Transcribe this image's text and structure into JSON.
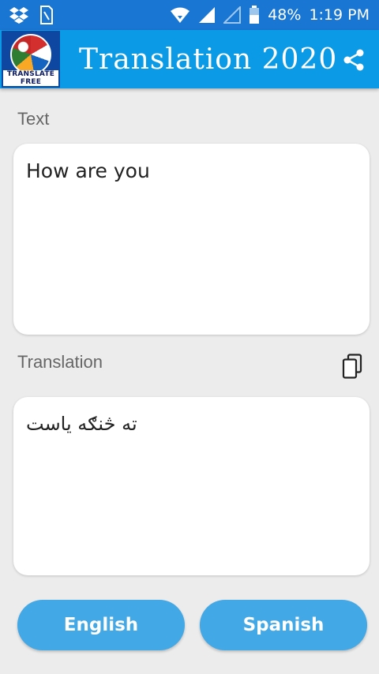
{
  "status_bar": {
    "battery": "48%",
    "time": "1:19 PM",
    "icons": [
      "dropbox-icon",
      "sim-card-icon",
      "wifi-icon",
      "signal-icon",
      "signal-empty-icon",
      "battery-icon"
    ]
  },
  "app_bar": {
    "logo_text": "TRANSLATE FREE",
    "title": "Translation 2020",
    "share_icon": "share-icon"
  },
  "input_section": {
    "label": "Text",
    "value": "How are you"
  },
  "output_section": {
    "label": "Translation",
    "value": "ته څنګه یاست",
    "copy_icon": "copy-icon"
  },
  "languages": {
    "source": "English",
    "target": "Spanish"
  },
  "colors": {
    "status_bar": "#1976d2",
    "app_bar": "#0b9ae6",
    "button": "#42a8e6",
    "background": "#ececec"
  }
}
